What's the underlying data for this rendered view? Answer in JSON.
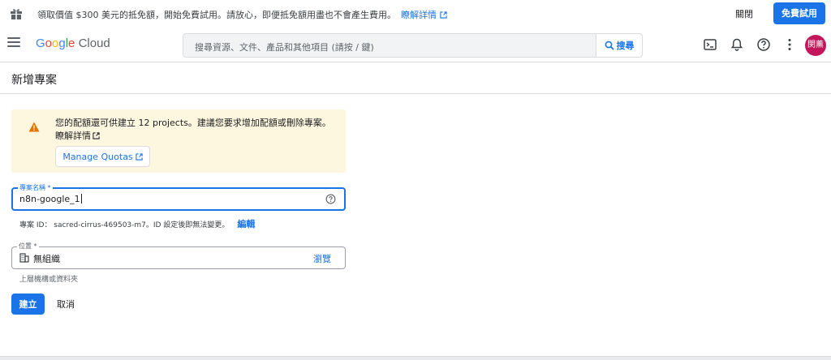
{
  "promo": {
    "message": "領取價值 $300 美元的抵免額，開始免費試用。請放心，即便抵免額用盡也不會產生費用。",
    "learn_more": "瞭解詳情",
    "dismiss": "關閉",
    "start_trial": "免費試用"
  },
  "appbar": {
    "logo_google": "Google",
    "logo_cloud": "Cloud",
    "search_placeholder": "搜尋資源、文件、產品和其他項目 (請按 / 鍵)",
    "search_button": "搜尋",
    "avatar_initials": "閔薰"
  },
  "page": {
    "title": "新增專案"
  },
  "warning": {
    "text": "您的配額還可供建立 12 projects。建議您要求增加配額或刪除專案。",
    "link": "瞭解詳情",
    "manage_quotas": "Manage Quotas"
  },
  "project_name": {
    "label": "專案名稱 *",
    "value": "n8n-google_1"
  },
  "project_id": {
    "text": "專案 ID： sacred-cirrus-469503-m7。ID 設定後即無法變更。",
    "edit": "編輯"
  },
  "location": {
    "label": "位置 *",
    "value": "無組織",
    "browse": "瀏覽",
    "helper": "上層機構或資料夾"
  },
  "actions": {
    "create": "建立",
    "cancel": "取消"
  },
  "colors": {
    "primary": "#1a73e8",
    "warning_bg": "#fef7e0",
    "warning_icon": "#e37400",
    "avatar_bg": "#c2185b"
  }
}
